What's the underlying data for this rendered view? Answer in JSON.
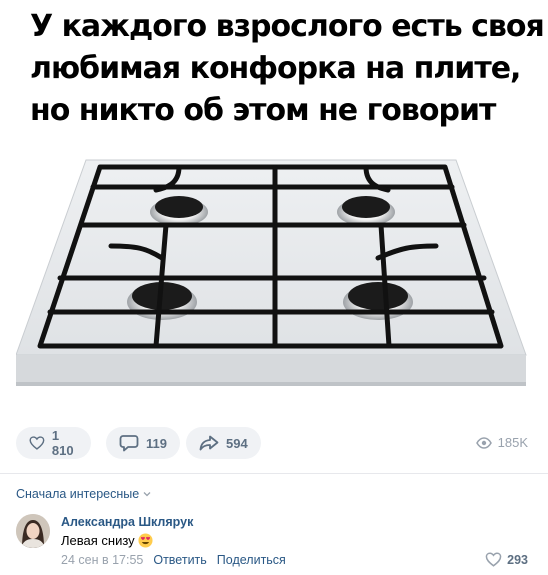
{
  "post": {
    "title_lines": [
      "У каждого взрослого есть своя",
      "любимая конфорка на плите,",
      "но никто об этом не говорит"
    ],
    "image_subject": "white gas stove top with four burners and black grates"
  },
  "actions": {
    "likes": "1 810",
    "comments": "119",
    "shares": "594",
    "views": "185K"
  },
  "comments_section": {
    "sort_label": "Сначала интересные",
    "comment": {
      "author": "Александра Шклярук",
      "text": "Левая снизу",
      "emoji": "heart-eyes-emoji",
      "time": "24 сен в 17:55",
      "reply_label": "Ответить",
      "share_label": "Поделиться",
      "likes": "293"
    }
  },
  "colors": {
    "link": "#2a5885",
    "pill_bg": "#f0f2f5",
    "muted": "#99a2ad",
    "icon": "#5d6f82"
  }
}
